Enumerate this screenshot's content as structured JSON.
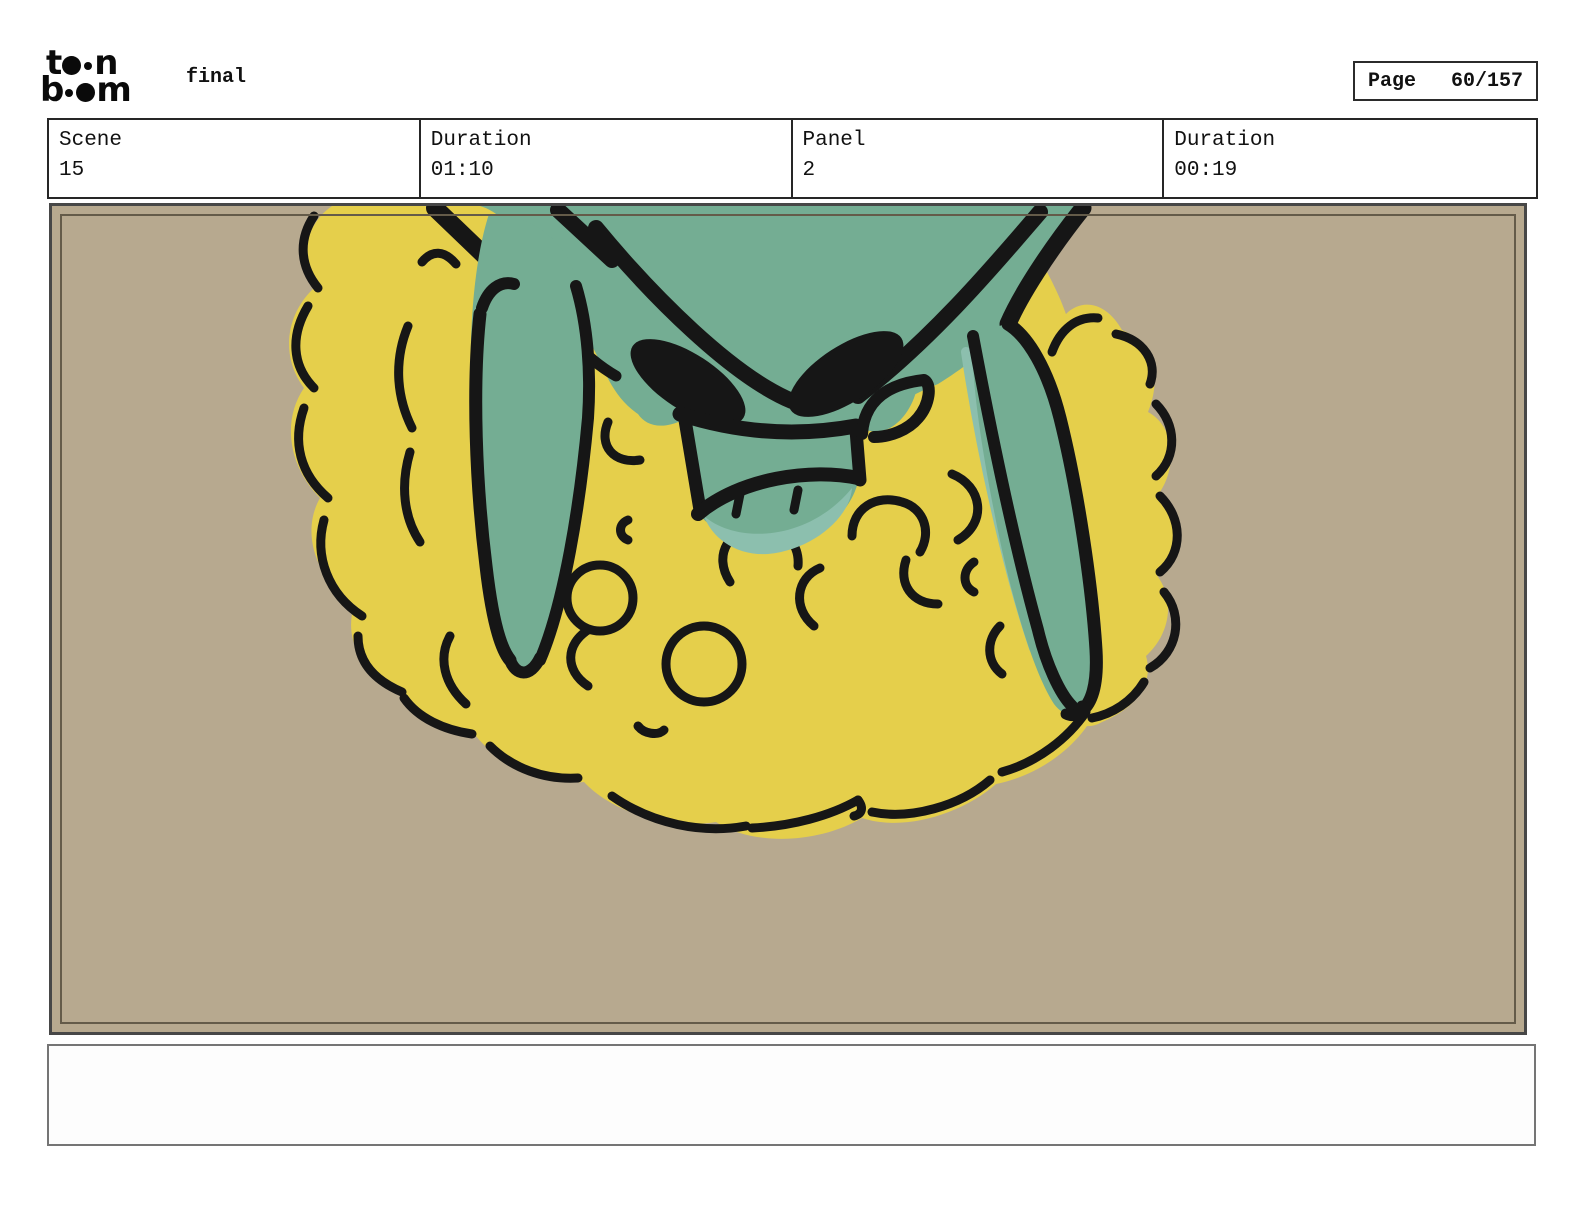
{
  "header": {
    "logo": {
      "line1_start": "t",
      "line1_end": "n",
      "line2_start": "b",
      "line2_end": "m",
      "brand": "toon boom"
    },
    "status_label": "final",
    "page_label": "Page",
    "page_value": "60/157"
  },
  "info_cells": [
    {
      "label": "Scene",
      "value": "15"
    },
    {
      "label": "Duration",
      "value": "01:10"
    },
    {
      "label": "Panel",
      "value": "2"
    },
    {
      "label": "Duration",
      "value": "00:19"
    }
  ],
  "panel": {
    "description": "storyboard drawing: angry teal creature face leaning down from top with drooping ears, billowing yellow smoke cloud, tan background"
  },
  "caption": {
    "text": ""
  },
  "colors": {
    "tan": "#b7a98f",
    "yellow": "#e5cf4b",
    "teal": "#74ad93",
    "teal_light": "#8cbfae",
    "ink": "#161616"
  }
}
